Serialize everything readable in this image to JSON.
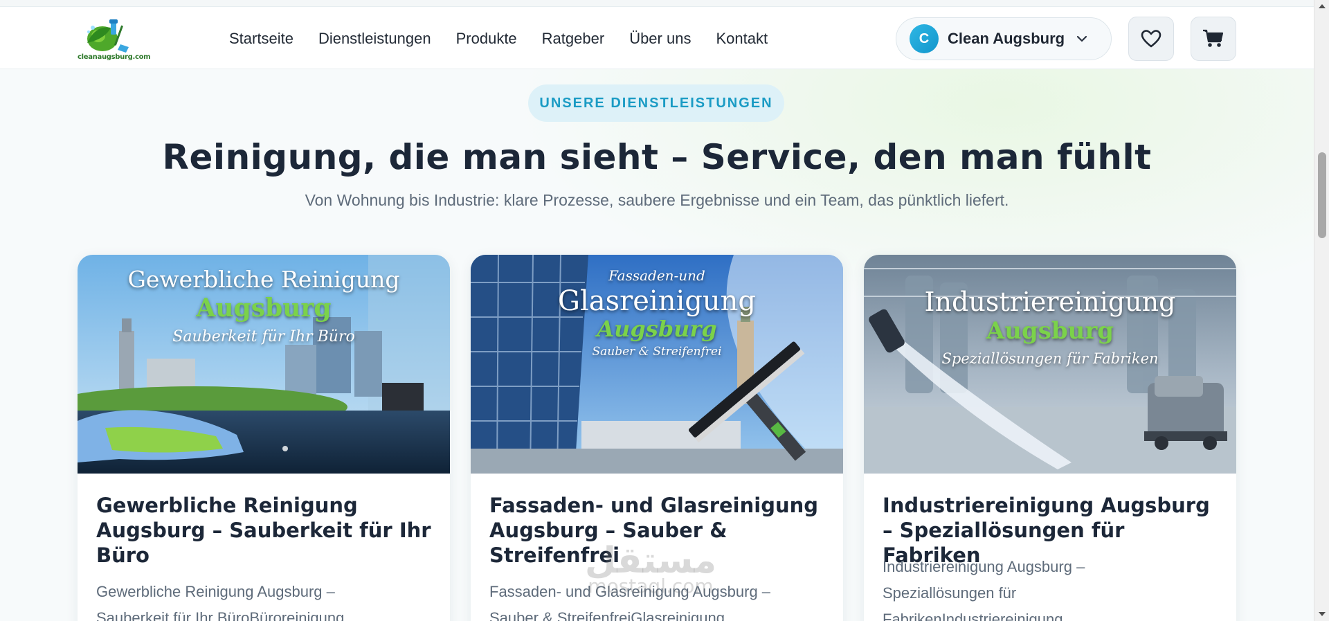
{
  "header": {
    "logo_text": "cleanaugsburg.com",
    "nav": [
      "Startseite",
      "Dienstleistungen",
      "Produkte",
      "Ratgeber",
      "Über uns",
      "Kontakt"
    ],
    "account": {
      "initial": "C",
      "name": "Clean Augsburg"
    },
    "icons": {
      "wishlist": "heart-icon",
      "cart": "cart-icon",
      "chevron": "chevron-down-icon"
    }
  },
  "section": {
    "badge": "UNSERE DIENSTLEISTUNGEN",
    "title": "Reinigung, die man sieht – Service, den man fühlt",
    "subtitle": "Von Wohnung bis Industrie: klare Prozesse, saubere Ergebnisse und ein Team, das pünktlich liefert."
  },
  "cards": [
    {
      "overlay_line1": "Gewerbliche Reinigung",
      "overlay_line2": "Augsburg",
      "overlay_line3": "Sauberkeit für Ihr Büro",
      "title": "Gewerbliche Reinigung Augsburg – Sauberkeit für Ihr Büro",
      "desc_line1": "Gewerbliche Reinigung Augsburg –",
      "desc_line2": "Sauberkeit für Ihr BüroBüroreinigung"
    },
    {
      "overlay_line1": "Fassaden-und",
      "overlay_line2": "Glasreinigung",
      "overlay_line3": "Augsburg",
      "overlay_line4": "Sauber & Streifenfrei",
      "title": "Fassaden- und Glasreinigung Augsburg – Sauber & Streifenfrei",
      "desc_line1": "Fassaden- und Glasreinigung Augsburg –",
      "desc_line2": "Sauber & StreifenfreiGlasreinigung"
    },
    {
      "overlay_line1": "Industriereinigung",
      "overlay_line2": "Augsburg",
      "overlay_line3": "Speziallösungen für Fabriken",
      "title": "Industriereinigung Augsburg – Speziallösungen für Fabriken",
      "desc_line1": "Industriereinigung Augsburg –",
      "desc_line2": "Speziallösungen für",
      "desc_line3": "FabrikenIndustriereinigung"
    }
  ],
  "watermark": {
    "main": "مستقل",
    "sub": "mostaql.com"
  },
  "colors": {
    "accent": "#1a9bc4",
    "badge_bg": "#ddf1f8",
    "title": "#1c2738",
    "brand_green": "#5cb82a"
  }
}
